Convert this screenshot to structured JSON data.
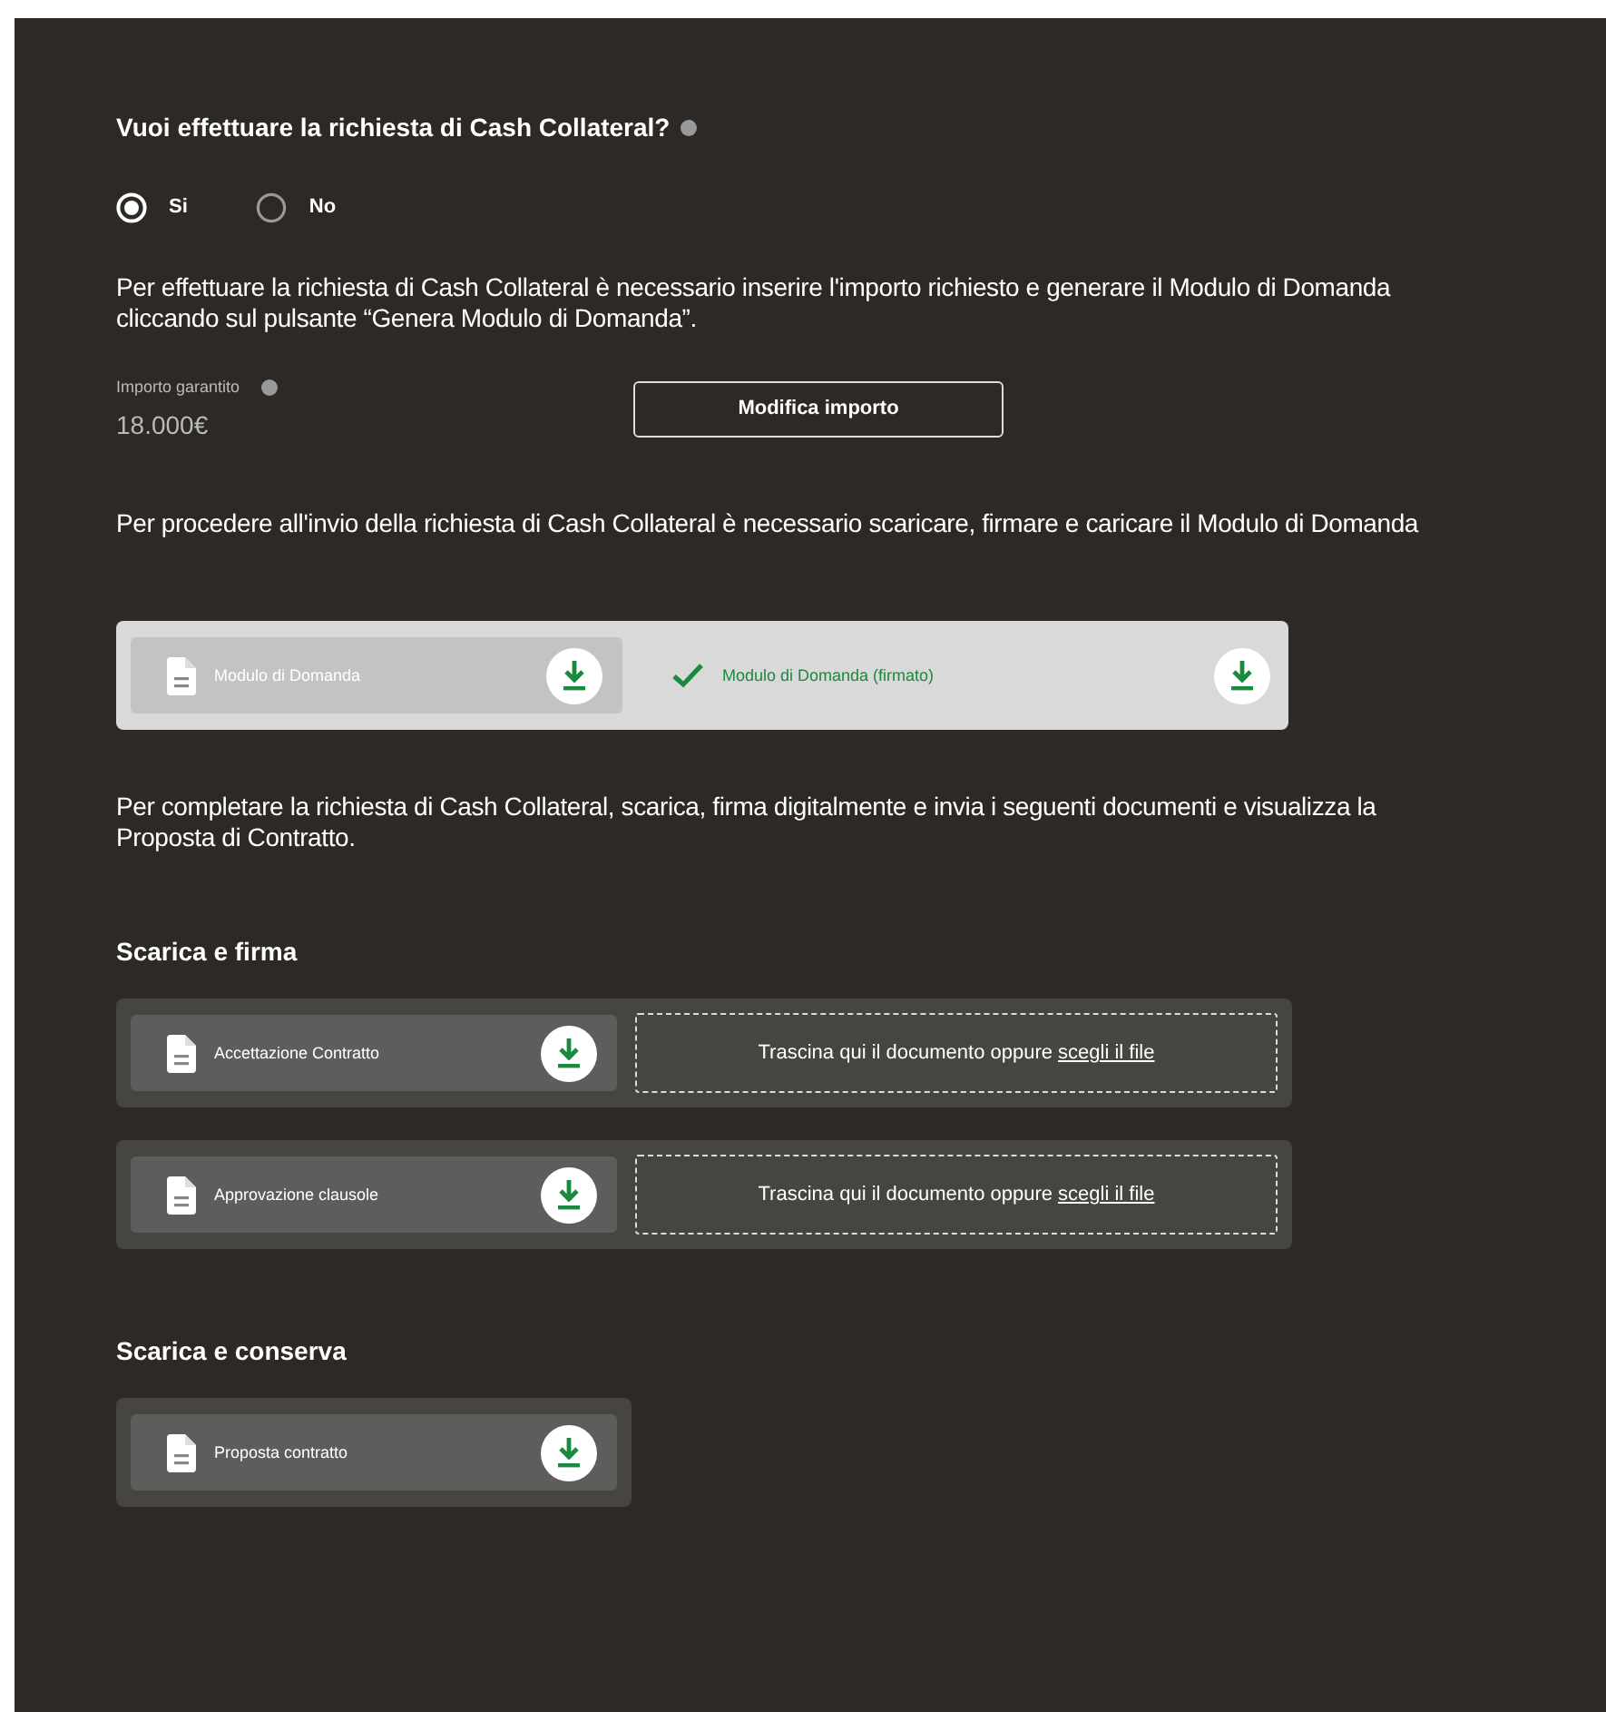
{
  "question": {
    "text": "Vuoi effettuare la richiesta di Cash Collateral?",
    "options": [
      {
        "label": "Si",
        "selected": true
      },
      {
        "label": "No",
        "selected": false
      }
    ]
  },
  "intro": "Per effettuare la richiesta di Cash Collateral è necessario inserire l'importo richiesto e generare il Modulo di Domanda cliccando sul pulsante “Genera Modulo di Domanda”.",
  "amount": {
    "label": "Importo garantito",
    "value": "18.000€"
  },
  "edit_button": "Modifica importo",
  "upload_intro": "Per procedere all'invio della richiesta di Cash Collateral è necessario scaricare, firmare e caricare il Modulo di Domanda",
  "module_items": [
    {
      "kind": "document",
      "label": "Modulo di Domanda"
    },
    {
      "kind": "signed",
      "label": "Modulo di Domanda (firmato)"
    }
  ],
  "complete_intro": "Per completare la richiesta di Cash Collateral, scarica, firma digitalmente e invia i seguenti documenti e visualizza la Proposta di Contratto.",
  "sections": [
    {
      "title": "Scarica e firma",
      "rows": [
        {
          "label": "Accettazione Contratto",
          "dropzone": {
            "text": "Trascina qui il documento oppure",
            "link": "scegli il file"
          }
        },
        {
          "label": "Approvazione clausole",
          "dropzone": {
            "text": "Trascina qui il documento oppure",
            "link": "scegli il file"
          }
        }
      ]
    },
    {
      "title": "Scarica e conserva",
      "rows": [
        {
          "label": "Proposta contratto"
        }
      ]
    }
  ]
}
